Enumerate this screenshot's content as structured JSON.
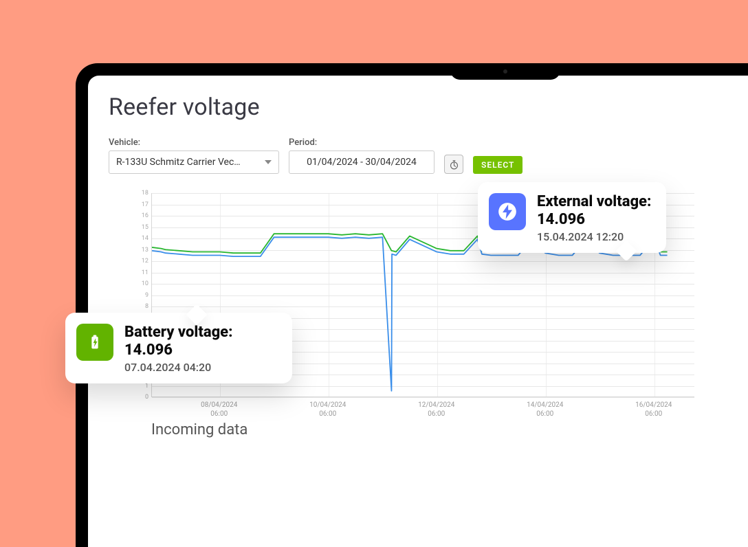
{
  "page": {
    "title": "Reefer voltage",
    "incoming_label": "Incoming data"
  },
  "controls": {
    "vehicle_label": "Vehicle:",
    "vehicle_value": "R-133U  Schmitz Carrier Vec…",
    "period_label": "Period:",
    "period_value": "01/04/2024 - 30/04/2024",
    "select_btn": "SELECT"
  },
  "tooltips": {
    "battery": {
      "title_line1": "Battery voltage:",
      "title_line2": "14.096",
      "timestamp": "07.04.2024  04:20"
    },
    "external": {
      "title_line1": "External voltage:",
      "title_line2": "14.096",
      "timestamp": "15.04.2024  12:20"
    }
  },
  "colors": {
    "series_battery": "#28b62f",
    "series_external": "#3a8eea",
    "accent": "#76c100",
    "tip_green": "#62b300",
    "tip_blue": "#5874ff",
    "backdrop": "#ff9c82"
  },
  "chart_data": {
    "type": "line",
    "title": "Reefer voltage",
    "xlabel": "",
    "ylabel": "",
    "ylim": [
      0,
      18
    ],
    "x_axis": {
      "start": "07/04/2024 00:00",
      "end": "17/04/2024 00:00",
      "ticks": [
        {
          "date": "08/04/2024",
          "time": "06:00"
        },
        {
          "date": "10/04/2024",
          "time": "06:00"
        },
        {
          "date": "12/04/2024",
          "time": "06:00"
        },
        {
          "date": "14/04/2024",
          "time": "06:00"
        },
        {
          "date": "16/04/2024",
          "time": "06:00"
        }
      ]
    },
    "y_ticks": [
      18,
      17,
      16,
      15,
      14,
      13,
      12,
      11,
      10,
      9,
      8,
      7,
      6,
      5,
      4,
      3,
      2,
      1,
      0
    ],
    "x": [
      "07/04 00:00",
      "07/04 04:00",
      "07/04 06:00",
      "07/04 12:00",
      "07/04 18:00",
      "08/04 00:00",
      "08/04 06:00",
      "08/04 12:00",
      "08/04 18:00",
      "09/04 00:00",
      "09/04 06:00",
      "09/04 12:00",
      "09/04 18:00",
      "10/04 06:00",
      "10/04 12:00",
      "10/04 18:00",
      "11/04 00:00",
      "11/04 06:00",
      "11/04 10:00",
      "11/04 10:10",
      "11/04 12:00",
      "11/04 18:00",
      "12/04 06:00",
      "12/04 12:00",
      "12/04 18:00",
      "13/04 00:00",
      "13/04 02:00",
      "13/04 06:00",
      "13/04 12:00",
      "13/04 18:00",
      "14/04 00:00",
      "14/04 06:00",
      "14/04 12:00",
      "14/04 18:00",
      "15/04 00:00",
      "15/04 06:00",
      "15/04 12:00",
      "15/04 18:00",
      "16/04 00:00",
      "16/04 06:00",
      "16/04 09:00",
      "16/04 12:00"
    ],
    "series": [
      {
        "name": "Battery voltage",
        "color": "#28b62f",
        "values": [
          13.2,
          13.1,
          13.0,
          12.9,
          12.8,
          12.8,
          12.8,
          12.7,
          12.7,
          12.7,
          14.4,
          14.4,
          14.4,
          14.4,
          14.3,
          14.4,
          14.3,
          14.4,
          12.9,
          12.9,
          12.8,
          14.2,
          13.1,
          12.9,
          12.9,
          14.2,
          12.9,
          12.8,
          12.8,
          12.8,
          14.2,
          13.0,
          12.8,
          12.8,
          14.2,
          13.0,
          12.8,
          12.8,
          12.8,
          14.3,
          12.8,
          12.8
        ]
      },
      {
        "name": "External voltage",
        "color": "#3a8eea",
        "values": [
          12.9,
          12.8,
          12.7,
          12.6,
          12.5,
          12.5,
          12.5,
          12.4,
          12.4,
          12.4,
          14.1,
          14.1,
          14.1,
          14.1,
          14.0,
          14.1,
          14.0,
          14.1,
          0.5,
          12.6,
          12.5,
          13.9,
          12.8,
          12.6,
          12.6,
          13.9,
          12.6,
          12.5,
          12.5,
          12.5,
          13.9,
          12.7,
          12.5,
          12.5,
          13.9,
          12.7,
          12.5,
          12.5,
          12.5,
          14.0,
          12.5,
          12.5
        ]
      }
    ]
  }
}
